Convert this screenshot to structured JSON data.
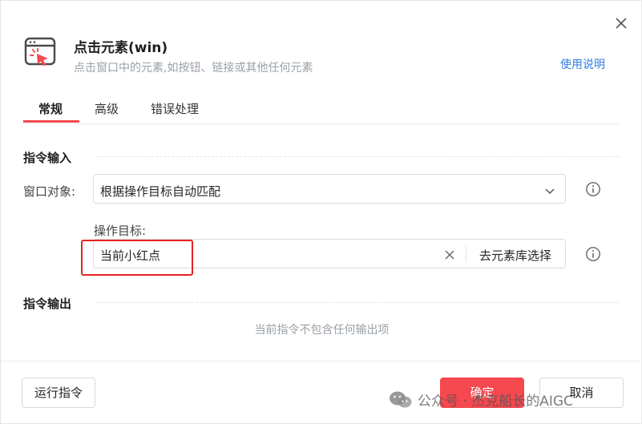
{
  "dialog": {
    "title": "点击元素(win)",
    "subtitle": "点击窗口中的元素,如按钮、链接或其他任何元素",
    "help_link": "使用说明",
    "icon": "click-element-icon"
  },
  "tabs": [
    {
      "label": "常规",
      "active": true
    },
    {
      "label": "高级",
      "active": false
    },
    {
      "label": "错误处理",
      "active": false
    }
  ],
  "input_section": {
    "title": "指令输入",
    "window_object": {
      "label": "窗口对象:",
      "value": "根据操作目标自动匹配"
    },
    "operation_target": {
      "label": "操作目标:",
      "value": "当前小红点",
      "library_button": "去元素库选择"
    }
  },
  "output_section": {
    "title": "指令输出",
    "empty_text": "当前指令不包含任何输出项"
  },
  "footer": {
    "run_button": "运行指令",
    "ok_button": "确定",
    "cancel_button": "取消"
  },
  "watermark": {
    "text": "公众号 · 杰克船长的AIGC",
    "icon": "wechat-icon"
  },
  "colors": {
    "accent": "#f5484f",
    "link": "#2f7de1",
    "highlight": "#e52323"
  }
}
